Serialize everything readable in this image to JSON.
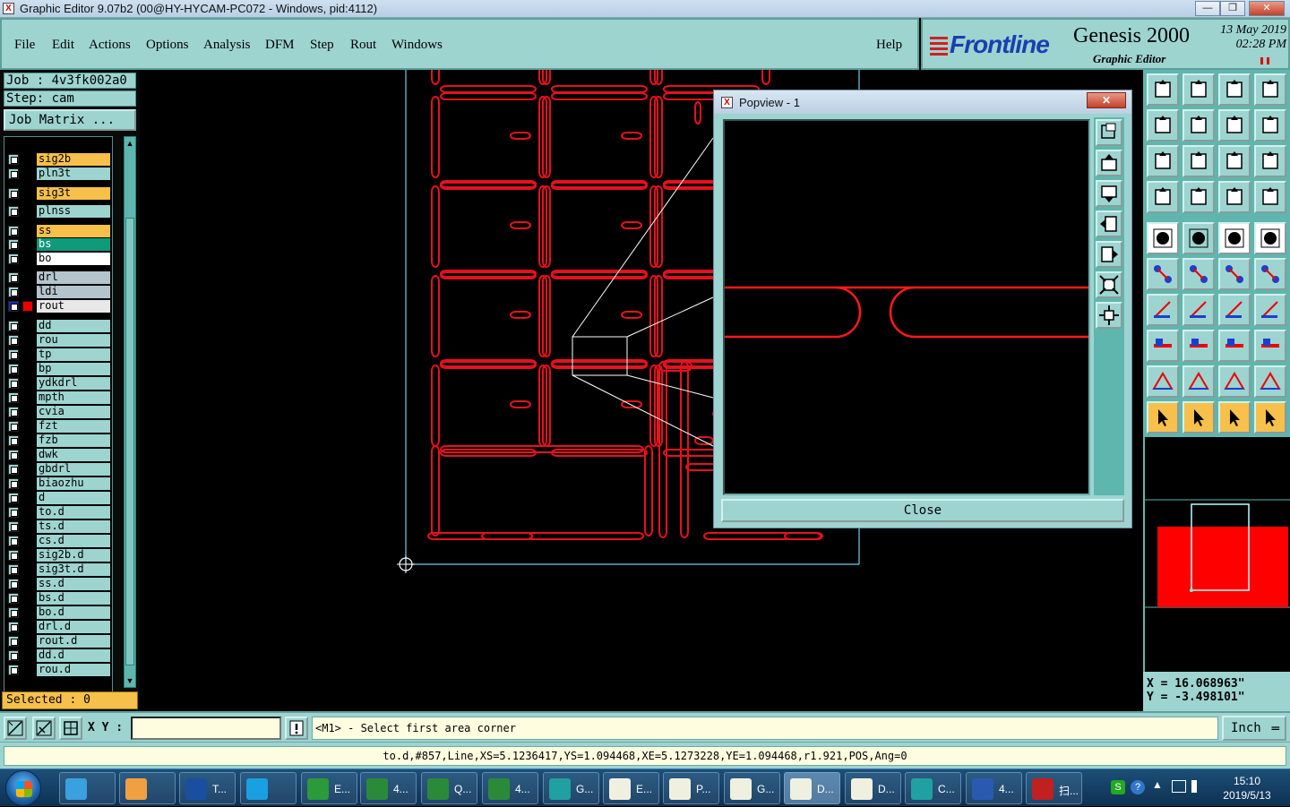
{
  "window": {
    "title": "Graphic Editor 9.07b2 (00@HY-HYCAM-PC072 - Windows, pid:4112)"
  },
  "menu": {
    "items": [
      "File",
      "Edit",
      "Actions",
      "Options",
      "Analysis",
      "DFM",
      "Step",
      "Rout",
      "Windows"
    ],
    "help": "Help"
  },
  "brand": {
    "logo": "Frontline",
    "product": "Genesis 2000",
    "subtitle": "Graphic Editor",
    "date": "13 May 2019",
    "time": "02:28 PM"
  },
  "job": {
    "job_line": "Job : 4v3fk002a0",
    "step_line": "Step: cam",
    "matrix_button": "Job Matrix ..."
  },
  "layers": [
    {
      "name": "sig2b",
      "color": "#f7c04a"
    },
    {
      "name": "pln3t",
      "color": "#9dd4d0"
    },
    {
      "name": "sig3t",
      "color": "#f7c04a"
    },
    {
      "name": "plnss",
      "color": "#9dd4d0"
    },
    {
      "name": "ss",
      "color": "#f7c04a"
    },
    {
      "name": "bs",
      "color": "#0f9a7a"
    },
    {
      "name": "bo",
      "color": "#ffffff"
    },
    {
      "name": "drl",
      "color": "#b4c4cc"
    },
    {
      "name": "ldi",
      "color": "#b4c4cc"
    },
    {
      "name": "rout",
      "color": "#e8e8e8",
      "active": true
    },
    {
      "name": "dd",
      "color": "#9dd4d0"
    },
    {
      "name": "rou",
      "color": "#9dd4d0"
    },
    {
      "name": "tp",
      "color": "#9dd4d0"
    },
    {
      "name": "bp",
      "color": "#9dd4d0"
    },
    {
      "name": "ydkdrl",
      "color": "#9dd4d0"
    },
    {
      "name": "mpth",
      "color": "#9dd4d0"
    },
    {
      "name": "cvia",
      "color": "#9dd4d0"
    },
    {
      "name": "fzt",
      "color": "#9dd4d0"
    },
    {
      "name": "fzb",
      "color": "#9dd4d0"
    },
    {
      "name": "dwk",
      "color": "#9dd4d0"
    },
    {
      "name": "gbdrl",
      "color": "#9dd4d0"
    },
    {
      "name": "biaozhu",
      "color": "#9dd4d0"
    },
    {
      "name": "d",
      "color": "#9dd4d0"
    },
    {
      "name": "to.d",
      "color": "#9dd4d0"
    },
    {
      "name": "ts.d",
      "color": "#9dd4d0"
    },
    {
      "name": "cs.d",
      "color": "#9dd4d0"
    },
    {
      "name": "sig2b.d",
      "color": "#9dd4d0"
    },
    {
      "name": "sig3t.d",
      "color": "#9dd4d0"
    },
    {
      "name": "ss.d",
      "color": "#9dd4d0"
    },
    {
      "name": "bs.d",
      "color": "#9dd4d0"
    },
    {
      "name": "bo.d",
      "color": "#9dd4d0"
    },
    {
      "name": "drl.d",
      "color": "#9dd4d0"
    },
    {
      "name": "rout.d",
      "color": "#9dd4d0"
    },
    {
      "name": "dd.d",
      "color": "#9dd4d0"
    },
    {
      "name": "rou.d",
      "color": "#9dd4d0"
    }
  ],
  "selected": "Selected : 0",
  "popview": {
    "title": "Popview - 1",
    "close_x": "✕",
    "close_button": "Close"
  },
  "coords": {
    "x": "X = 16.068963\"",
    "y": "Y = -3.498101\""
  },
  "command": {
    "xy_label": "X Y :",
    "xy_value": "",
    "message": "<M1> - Select first area corner",
    "units": "Inch"
  },
  "status": {
    "text": "to.d,#857,Line,XS=5.1236417,YS=1.094468,XE=5.1273228,YE=1.094468,r1.921,POS,Ang=0"
  },
  "taskbar": {
    "tasks": [
      "",
      "",
      "T...",
      "",
      "E...",
      "4...",
      "Q...",
      "4...",
      "G...",
      "E...",
      "P...",
      "G...",
      "D...",
      "D...",
      "C...",
      "4...",
      "扫..."
    ],
    "clock_time": "15:10",
    "clock_date": "2019/5/13"
  },
  "colors": {
    "panel": "#9dd4d0",
    "accent_red": "#ff0000",
    "highlight": "#f7c04a"
  }
}
